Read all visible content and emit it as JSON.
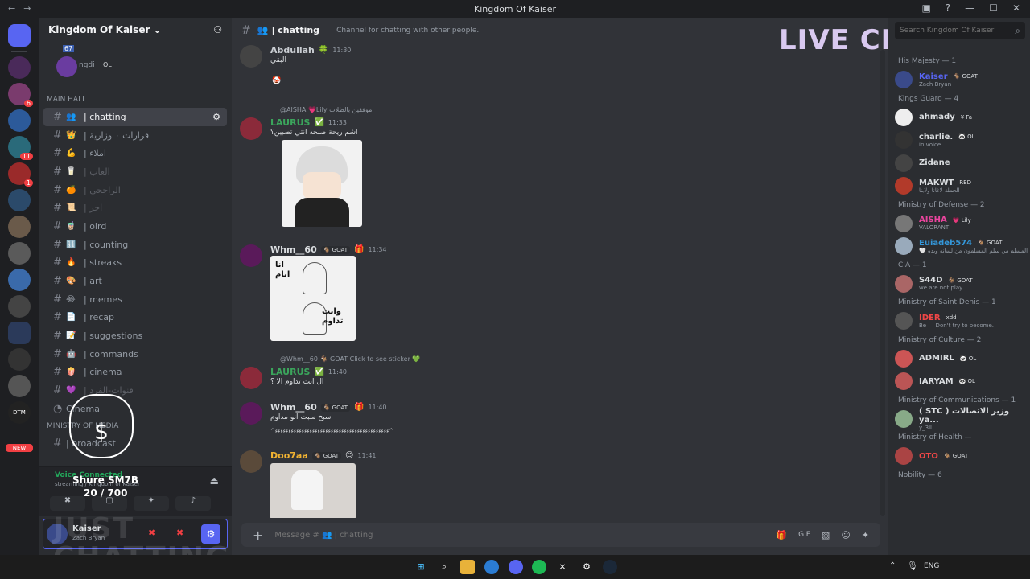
{
  "window": {
    "title": "Kingdom Of Kaiser",
    "buttons": [
      "—",
      "☐",
      "✕"
    ]
  },
  "overlay": {
    "live_chat": "LIVE CHAT",
    "just_chatting": "JUST\nCHATTING",
    "goal_label": "Shure SM7B",
    "goal_progress": "20 / 700",
    "goal_fraction": 0.0286
  },
  "server": {
    "name": "Kingdom Of Kaiser",
    "user_partial": "ngdi",
    "user_tag": "OL",
    "counter": "67",
    "new_badge": "NEW",
    "badges": [
      "11",
      "1",
      "6"
    ]
  },
  "channels": {
    "category": "MAIN HALL",
    "items": [
      {
        "emoji": "👥",
        "label": "| chatting",
        "active": true,
        "muted": false
      },
      {
        "emoji": "👑",
        "label": "| قرارات ٠ وزارية",
        "active": false,
        "muted": false
      },
      {
        "emoji": "💪",
        "label": "| املاء",
        "active": false,
        "muted": false
      },
      {
        "emoji": "🥛",
        "label": "| العاب",
        "active": false,
        "muted": true
      },
      {
        "emoji": "🍊",
        "label": "| الراجحي",
        "active": false,
        "muted": true
      },
      {
        "emoji": "📜",
        "label": "| اجر",
        "active": false,
        "muted": true
      },
      {
        "emoji": "🧋",
        "label": "| olrd",
        "active": false,
        "muted": false
      },
      {
        "emoji": "🔢",
        "label": "| counting",
        "active": false,
        "muted": false
      },
      {
        "emoji": "🔥",
        "label": "| streaks",
        "active": false,
        "muted": false
      },
      {
        "emoji": "🎨",
        "label": "| art",
        "active": false,
        "muted": false
      },
      {
        "emoji": "😂",
        "label": "| memes",
        "active": false,
        "muted": false
      },
      {
        "emoji": "📄",
        "label": "| recap",
        "active": false,
        "muted": false
      },
      {
        "emoji": "📝",
        "label": "| suggestions",
        "active": false,
        "muted": false
      },
      {
        "emoji": "🤖",
        "label": "| commands",
        "active": false,
        "muted": false
      },
      {
        "emoji": "🍿",
        "label": "| cinema",
        "active": false,
        "muted": false
      },
      {
        "emoji": "💜",
        "label": "| قنوات-الفرد",
        "active": false,
        "muted": true
      }
    ],
    "extra": [
      "Cinema",
      "Ministry of Media",
      "| broadcast"
    ]
  },
  "voice": {
    "status": "Voice Connected",
    "sub": "streaming / Kingdom of Kaiser"
  },
  "user": {
    "name": "Kaiser",
    "sub": "Zach Bryan"
  },
  "chat": {
    "channel": "| chatting",
    "topic": "Channel for chatting with other people.",
    "composer_placeholder": "Message # 👥 | chatting",
    "messages": [
      {
        "name": "Abdullah",
        "color": "#c9cdd2",
        "time": "11:30",
        "tags": [
          "🍀"
        ],
        "text": "البقي",
        "extra": "🤡"
      },
      {
        "reply": "@AISHA 💗Lily موفقين بالطلاب",
        "name": "LAURUS",
        "color": "#3ba55c",
        "time": "11:33",
        "tags": [
          "✅"
        ],
        "text": "اشم ريحة صبحه انتي تصبين؟",
        "image": "anime"
      },
      {
        "name": "Whm__60",
        "color": "#dbdee1",
        "time": "11:34",
        "tags": [
          "🐐 GOAT",
          "🎁"
        ],
        "text": "",
        "image": "meme",
        "image_top": "انا\nانام",
        "image_bottom": "وانت\nتداوم"
      },
      {
        "reply": "@Whm__60 🐐 GOAT Click to see sticker 💚",
        "name": "LAURUS",
        "color": "#3ba55c",
        "time": "11:40",
        "tags": [
          "✅"
        ],
        "text": "ال انت تداوم الا ؟"
      },
      {
        "name": "Whm__60",
        "color": "#dbdee1",
        "time": "11:40",
        "tags": [
          "🐐 GOAT",
          "🎁"
        ],
        "text": "سبح سبت انو مداوم",
        "extra2": "^ءءءءءءءءءءءءءءءءءءءءءءءءءءءءءءءءءءءءءءءءءءء^"
      },
      {
        "name": "Doo7aa",
        "color": "#f0b232",
        "time": "11:41",
        "tags": [
          "🐐 GOAT",
          "😊"
        ],
        "text": "",
        "image": "photo"
      }
    ]
  },
  "members": {
    "search_placeholder": "Search Kingdom Of Kaiser",
    "groups": [
      {
        "title": "His Majesty — 1",
        "members": [
          {
            "name": "Kaiser",
            "color": "#5865f2",
            "tag": "🐐 GOAT",
            "sub": "Zach Bryan"
          }
        ]
      },
      {
        "title": "Kings Guard — 4",
        "members": [
          {
            "name": "ahmady",
            "color": "#dbdee1",
            "tag": "¥ Fa",
            "sub": ""
          },
          {
            "name": "charlie.",
            "color": "#dbdee1",
            "tag": "🐼 OL",
            "sub": "in voice"
          },
          {
            "name": "Zidane",
            "color": "#dbdee1",
            "tag": "",
            "sub": ""
          },
          {
            "name": "MAKWT",
            "color": "#dbdee1",
            "tag": "RED",
            "sub": "الحملة لاغانا ولابنا"
          }
        ]
      },
      {
        "title": "Ministry of Defense — 2",
        "members": [
          {
            "name": "AISHA",
            "color": "#eb459e",
            "tag": "💗 Lily",
            "sub": "VALORANT"
          },
          {
            "name": "Euiadeb574",
            "color": "#3498db",
            "tag": "🐐 GOAT",
            "sub": "🤍 المسلم من سلم المسلمون من لسانه ويده"
          }
        ]
      },
      {
        "title": "CIA — 1",
        "members": [
          {
            "name": "S44D",
            "color": "#dbdee1",
            "tag": "🐐 GOAT",
            "sub": "we are not play"
          }
        ]
      },
      {
        "title": "Ministry of Saint Denis — 1",
        "members": [
          {
            "name": "IDER",
            "color": "#f04747",
            "tag": "xdd",
            "sub": "Be — Don't try to become."
          }
        ]
      },
      {
        "title": "Ministry of Culture — 2",
        "members": [
          {
            "name": "ADMIRL",
            "color": "#dbdee1",
            "tag": "🐼 OL",
            "sub": ""
          },
          {
            "name": "IARYAM",
            "color": "#dbdee1",
            "tag": "🐼 OL",
            "sub": ""
          }
        ]
      },
      {
        "title": "Ministry of Communications — 1",
        "members": [
          {
            "name": "( STC ) وزير الاتصالات ya...",
            "color": "#dbdee1",
            "tag": "",
            "sub": "y_3ll"
          }
        ]
      },
      {
        "title": "Ministry of Health —",
        "members": [
          {
            "name": "OTO",
            "color": "#f04747",
            "tag": "🐐 GOAT",
            "sub": ""
          }
        ]
      },
      {
        "title": "Nobility — 6",
        "members": []
      }
    ]
  },
  "taskbar": {
    "lang": "ENG"
  }
}
